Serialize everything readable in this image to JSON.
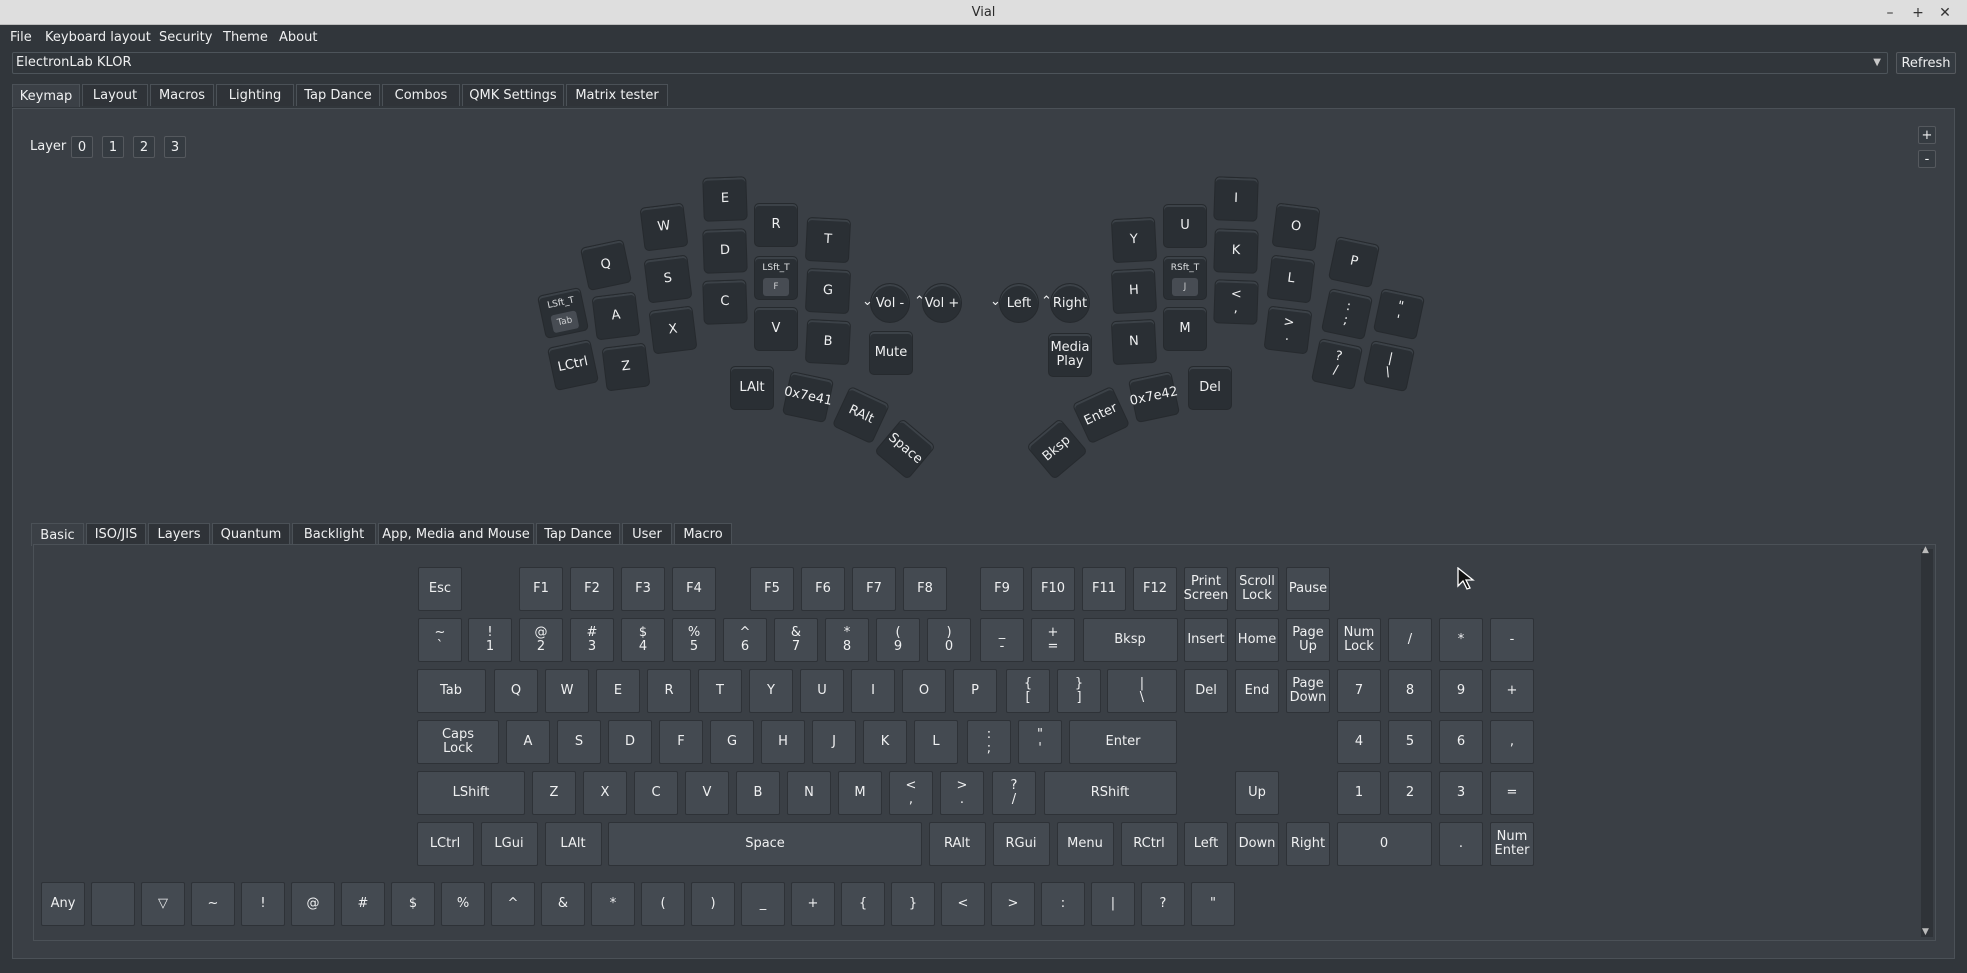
{
  "window": {
    "title": "Vial",
    "controls": [
      "–",
      "+",
      "✕"
    ]
  },
  "menu": [
    "File",
    "Keyboard layout",
    "Security",
    "Theme",
    "About"
  ],
  "device": {
    "selected": "ElectronLab KLOR",
    "refresh": "Refresh"
  },
  "tabs": [
    "Keymap",
    "Layout",
    "Macros",
    "Lighting",
    "Tap Dance",
    "Combos",
    "QMK Settings",
    "Matrix tester"
  ],
  "layer": {
    "label": "Layer",
    "items": [
      "0",
      "1",
      "2",
      "3"
    ],
    "plus": "+",
    "minus": "-"
  },
  "keyboard": {
    "keys": [
      {
        "n": "key-q",
        "l": [
          "Q"
        ]
      },
      {
        "n": "key-w",
        "l": [
          "W"
        ]
      },
      {
        "n": "key-e",
        "l": [
          "E"
        ]
      },
      {
        "n": "key-r",
        "l": [
          "R"
        ]
      },
      {
        "n": "key-t",
        "l": [
          "T"
        ]
      },
      {
        "n": "key-tab",
        "l": [
          "LSft_T"
        ],
        "inner": "Tab"
      },
      {
        "n": "key-a",
        "l": [
          "A"
        ]
      },
      {
        "n": "key-s",
        "l": [
          "S"
        ]
      },
      {
        "n": "key-d",
        "l": [
          "D"
        ]
      },
      {
        "n": "key-f",
        "l": [
          "LSft_T"
        ],
        "inner": "F"
      },
      {
        "n": "key-g",
        "l": [
          "G"
        ]
      },
      {
        "n": "key-lctrl",
        "l": [
          "LCtrl"
        ]
      },
      {
        "n": "key-z",
        "l": [
          "Z"
        ]
      },
      {
        "n": "key-x",
        "l": [
          "X"
        ]
      },
      {
        "n": "key-c",
        "l": [
          "C"
        ]
      },
      {
        "n": "key-v",
        "l": [
          "V"
        ]
      },
      {
        "n": "key-b",
        "l": [
          "B"
        ]
      },
      {
        "n": "key-mute",
        "l": [
          "Mute"
        ]
      },
      {
        "n": "key-lalt",
        "l": [
          "LAlt"
        ]
      },
      {
        "n": "key-0x7e41",
        "l": [
          "0x7e41"
        ]
      },
      {
        "n": "key-ralt",
        "l": [
          "RAlt"
        ]
      },
      {
        "n": "key-space",
        "l": [
          "Space"
        ]
      },
      {
        "n": "key-y",
        "l": [
          "Y"
        ]
      },
      {
        "n": "key-u",
        "l": [
          "U"
        ]
      },
      {
        "n": "key-i",
        "l": [
          "I"
        ]
      },
      {
        "n": "key-o",
        "l": [
          "O"
        ]
      },
      {
        "n": "key-p",
        "l": [
          "P"
        ]
      },
      {
        "n": "key-h",
        "l": [
          "H"
        ]
      },
      {
        "n": "key-j",
        "l": [
          "RSft_T"
        ],
        "inner": "J"
      },
      {
        "n": "key-k",
        "l": [
          "K"
        ]
      },
      {
        "n": "key-l",
        "l": [
          "L"
        ]
      },
      {
        "n": "key-semicolon",
        "l": [
          ":",
          ";"
        ]
      },
      {
        "n": "key-quote",
        "l": [
          "\"",
          "'"
        ]
      },
      {
        "n": "key-n",
        "l": [
          "N"
        ]
      },
      {
        "n": "key-m",
        "l": [
          "M"
        ]
      },
      {
        "n": "key-comma",
        "l": [
          "<",
          ","
        ]
      },
      {
        "n": "key-period",
        "l": [
          ">",
          "."
        ]
      },
      {
        "n": "key-slash",
        "l": [
          "?",
          "/"
        ]
      },
      {
        "n": "key-pipe",
        "l": [
          "|",
          "\\"
        ]
      },
      {
        "n": "key-media-play",
        "l": [
          "Media",
          "Play"
        ]
      },
      {
        "n": "key-del",
        "l": [
          "Del"
        ]
      },
      {
        "n": "key-0x7e42",
        "l": [
          "0x7e42"
        ]
      },
      {
        "n": "key-enter",
        "l": [
          "Enter"
        ]
      },
      {
        "n": "key-bksp",
        "l": [
          "Bksp"
        ]
      }
    ],
    "encoders": [
      {
        "n": "encoder-vol-down",
        "l": "Vol -"
      },
      {
        "n": "encoder-vol-up",
        "l": "Vol +"
      },
      {
        "n": "encoder-left",
        "l": "Left"
      },
      {
        "n": "encoder-right",
        "l": "Right"
      }
    ]
  },
  "keycode_tabs": [
    "Basic",
    "ISO/JIS",
    "Layers",
    "Quantum",
    "Backlight",
    "App, Media and Mouse",
    "Tap Dance",
    "User",
    "Macro"
  ],
  "keycodes": [
    {
      "l": [
        "Esc"
      ]
    },
    {
      "l": [
        "F1"
      ]
    },
    {
      "l": [
        "F2"
      ]
    },
    {
      "l": [
        "F3"
      ]
    },
    {
      "l": [
        "F4"
      ]
    },
    {
      "l": [
        "F5"
      ]
    },
    {
      "l": [
        "F6"
      ]
    },
    {
      "l": [
        "F7"
      ]
    },
    {
      "l": [
        "F8"
      ]
    },
    {
      "l": [
        "F9"
      ]
    },
    {
      "l": [
        "F10"
      ]
    },
    {
      "l": [
        "F11"
      ]
    },
    {
      "l": [
        "F12"
      ]
    },
    {
      "l": [
        "Print",
        "Screen"
      ]
    },
    {
      "l": [
        "Scroll",
        "Lock"
      ]
    },
    {
      "l": [
        "Pause"
      ]
    },
    {
      "l": [
        "~",
        "`"
      ]
    },
    {
      "l": [
        "!",
        "1"
      ]
    },
    {
      "l": [
        "@",
        "2"
      ]
    },
    {
      "l": [
        "#",
        "3"
      ]
    },
    {
      "l": [
        "$",
        "4"
      ]
    },
    {
      "l": [
        "%",
        "5"
      ]
    },
    {
      "l": [
        "^",
        "6"
      ]
    },
    {
      "l": [
        "&",
        "7"
      ]
    },
    {
      "l": [
        "*",
        "8"
      ]
    },
    {
      "l": [
        "(",
        "9"
      ]
    },
    {
      "l": [
        ")",
        "0"
      ]
    },
    {
      "l": [
        "_",
        "-"
      ]
    },
    {
      "l": [
        "+",
        "="
      ]
    },
    {
      "l": [
        "Bksp"
      ]
    },
    {
      "l": [
        "Insert"
      ]
    },
    {
      "l": [
        "Home"
      ]
    },
    {
      "l": [
        "Page",
        "Up"
      ]
    },
    {
      "l": [
        "Num",
        "Lock"
      ]
    },
    {
      "l": [
        "/"
      ]
    },
    {
      "l": [
        "*"
      ]
    },
    {
      "l": [
        "-"
      ]
    },
    {
      "l": [
        "Tab"
      ]
    },
    {
      "l": [
        "Q"
      ]
    },
    {
      "l": [
        "W"
      ]
    },
    {
      "l": [
        "E"
      ]
    },
    {
      "l": [
        "R"
      ]
    },
    {
      "l": [
        "T"
      ]
    },
    {
      "l": [
        "Y"
      ]
    },
    {
      "l": [
        "U"
      ]
    },
    {
      "l": [
        "I"
      ]
    },
    {
      "l": [
        "O"
      ]
    },
    {
      "l": [
        "P"
      ]
    },
    {
      "l": [
        "{",
        "["
      ]
    },
    {
      "l": [
        "}",
        "]"
      ]
    },
    {
      "l": [
        "|",
        "\\"
      ]
    },
    {
      "l": [
        "Del"
      ]
    },
    {
      "l": [
        "End"
      ]
    },
    {
      "l": [
        "Page",
        "Down"
      ]
    },
    {
      "l": [
        "7"
      ]
    },
    {
      "l": [
        "8"
      ]
    },
    {
      "l": [
        "9"
      ]
    },
    {
      "l": [
        "+"
      ]
    },
    {
      "l": [
        "Caps",
        "Lock"
      ]
    },
    {
      "l": [
        "A"
      ]
    },
    {
      "l": [
        "S"
      ]
    },
    {
      "l": [
        "D"
      ]
    },
    {
      "l": [
        "F"
      ]
    },
    {
      "l": [
        "G"
      ]
    },
    {
      "l": [
        "H"
      ]
    },
    {
      "l": [
        "J"
      ]
    },
    {
      "l": [
        "K"
      ]
    },
    {
      "l": [
        "L"
      ]
    },
    {
      "l": [
        ":",
        ";"
      ]
    },
    {
      "l": [
        "\"",
        "'"
      ]
    },
    {
      "l": [
        "Enter"
      ]
    },
    {
      "l": [
        "4"
      ]
    },
    {
      "l": [
        "5"
      ]
    },
    {
      "l": [
        "6"
      ]
    },
    {
      "l": [
        ","
      ]
    },
    {
      "l": [
        "LShift"
      ]
    },
    {
      "l": [
        "Z"
      ]
    },
    {
      "l": [
        "X"
      ]
    },
    {
      "l": [
        "C"
      ]
    },
    {
      "l": [
        "V"
      ]
    },
    {
      "l": [
        "B"
      ]
    },
    {
      "l": [
        "N"
      ]
    },
    {
      "l": [
        "M"
      ]
    },
    {
      "l": [
        "<",
        ","
      ]
    },
    {
      "l": [
        ">",
        "."
      ]
    },
    {
      "l": [
        "?",
        "/"
      ]
    },
    {
      "l": [
        "RShift"
      ]
    },
    {
      "l": [
        "Up"
      ]
    },
    {
      "l": [
        "1"
      ]
    },
    {
      "l": [
        "2"
      ]
    },
    {
      "l": [
        "3"
      ]
    },
    {
      "l": [
        "="
      ]
    },
    {
      "l": [
        "LCtrl"
      ]
    },
    {
      "l": [
        "LGui"
      ]
    },
    {
      "l": [
        "LAlt"
      ]
    },
    {
      "l": [
        "Space"
      ]
    },
    {
      "l": [
        "RAlt"
      ]
    },
    {
      "l": [
        "RGui"
      ]
    },
    {
      "l": [
        "Menu"
      ]
    },
    {
      "l": [
        "RCtrl"
      ]
    },
    {
      "l": [
        "Left"
      ]
    },
    {
      "l": [
        "Down"
      ]
    },
    {
      "l": [
        "Right"
      ]
    },
    {
      "l": [
        "0"
      ]
    },
    {
      "l": [
        "."
      ]
    },
    {
      "l": [
        "Num",
        "Enter"
      ]
    },
    {
      "l": [
        "Any"
      ]
    },
    {
      "l": [
        ""
      ]
    },
    {
      "l": [
        "▽"
      ]
    },
    {
      "l": [
        "~"
      ]
    },
    {
      "l": [
        "!"
      ]
    },
    {
      "l": [
        "@"
      ]
    },
    {
      "l": [
        "#"
      ]
    },
    {
      "l": [
        "$"
      ]
    },
    {
      "l": [
        "%"
      ]
    },
    {
      "l": [
        "^"
      ]
    },
    {
      "l": [
        "&"
      ]
    },
    {
      "l": [
        "*"
      ]
    },
    {
      "l": [
        "("
      ]
    },
    {
      "l": [
        ")"
      ]
    },
    {
      "l": [
        "_"
      ]
    },
    {
      "l": [
        "+"
      ]
    },
    {
      "l": [
        "{"
      ]
    },
    {
      "l": [
        "}"
      ]
    },
    {
      "l": [
        "<"
      ]
    },
    {
      "l": [
        ">"
      ]
    },
    {
      "l": [
        ":"
      ]
    },
    {
      "l": [
        "|"
      ]
    },
    {
      "l": [
        "?"
      ]
    },
    {
      "l": [
        "\""
      ]
    }
  ],
  "colors": {
    "bg": "#31363b",
    "panel": "#3a3f45",
    "key": "#2a2f34",
    "keycode": "#444a51"
  }
}
